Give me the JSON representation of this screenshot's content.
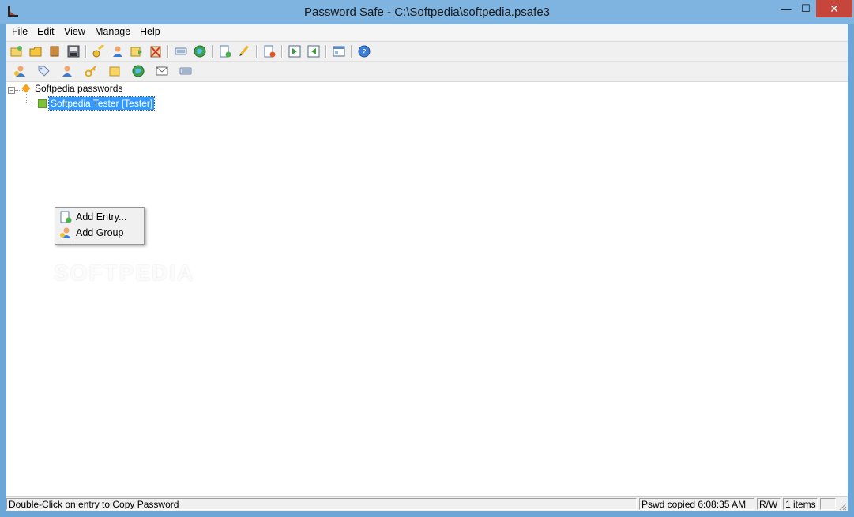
{
  "window": {
    "title": "Password Safe - C:\\Softpedia\\softpedia.psafe3",
    "controls": {
      "minimize": "—",
      "maximize": "☐",
      "close": "✕"
    }
  },
  "menu": [
    "File",
    "Edit",
    "View",
    "Manage",
    "Help"
  ],
  "toolbar1": [
    {
      "name": "new-database-icon"
    },
    {
      "name": "open-database-icon"
    },
    {
      "name": "close-database-icon"
    },
    {
      "name": "save-database-icon"
    },
    {
      "name": "copy-password-icon"
    },
    {
      "name": "copy-username-icon"
    },
    {
      "name": "copy-notes-icon"
    },
    {
      "name": "clear-clipboard-icon"
    },
    {
      "name": "autotype-icon"
    },
    {
      "name": "browse-url-icon"
    },
    {
      "name": "add-entry-icon"
    },
    {
      "name": "edit-entry-icon"
    },
    {
      "name": "delete-entry-icon"
    },
    {
      "name": "expand-all-icon"
    },
    {
      "name": "collapse-all-icon"
    },
    {
      "name": "options-icon"
    },
    {
      "name": "help-icon"
    }
  ],
  "toolbar2": [
    {
      "name": "add-group-icon"
    },
    {
      "name": "tag-icon"
    },
    {
      "name": "user-icon"
    },
    {
      "name": "key-icon"
    },
    {
      "name": "note-icon"
    },
    {
      "name": "globe-icon"
    },
    {
      "name": "email-icon"
    },
    {
      "name": "keyboard-icon"
    }
  ],
  "tree": {
    "root_label": "Softpedia passwords",
    "child_label": "Softpedia Tester [Tester]"
  },
  "context_menu": {
    "add_entry": "Add Entry...",
    "add_group": "Add Group"
  },
  "watermark": "SOFTPEDIA",
  "status": {
    "hint": "Double-Click on entry to Copy Password",
    "clipboard": "Pswd copied 6:08:35 AM",
    "mode": "R/W",
    "count": "1 items"
  },
  "colors": {
    "selection": "#3399ff",
    "titlebar": "#7fb3e0",
    "close_button": "#c7463c"
  }
}
